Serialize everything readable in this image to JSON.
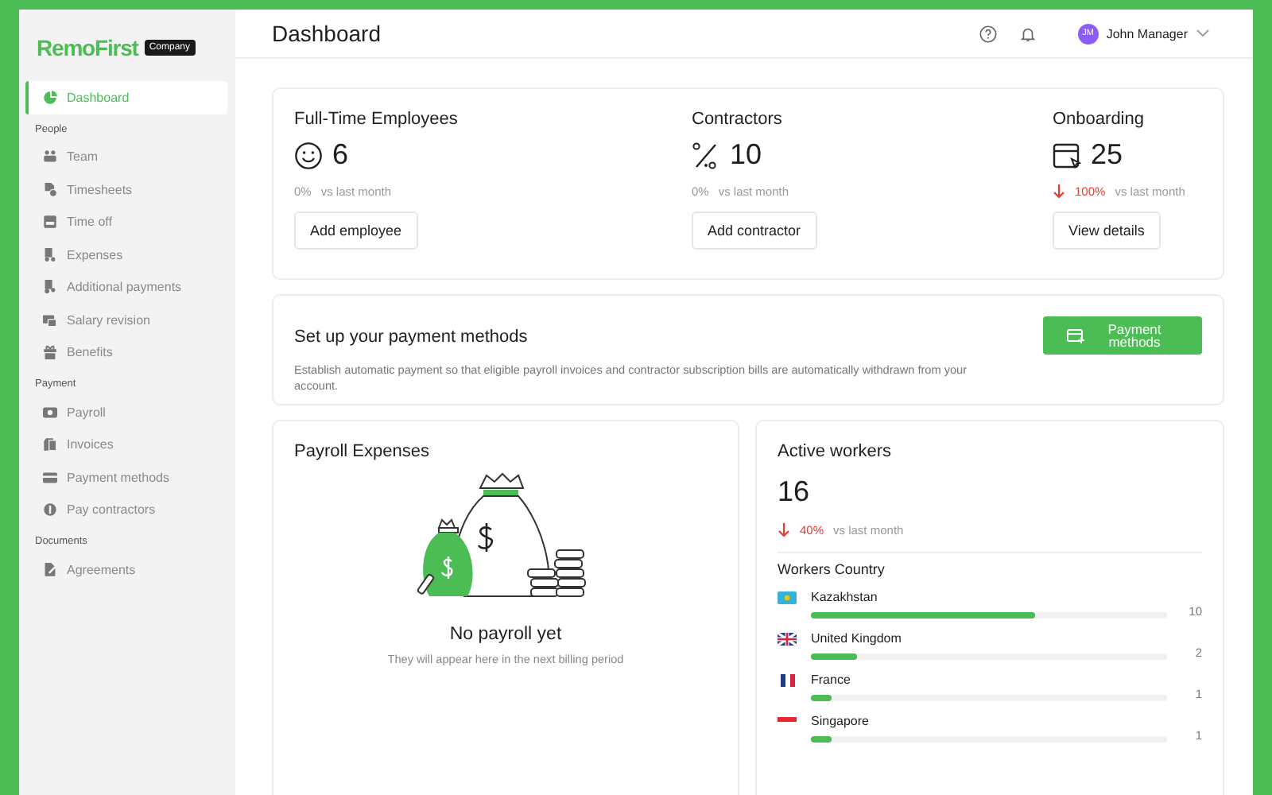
{
  "sidebar": {
    "logo": "RemoFirst",
    "badge": "Company",
    "items": [
      {
        "kind": "item",
        "label": "Dashboard",
        "selected": true
      },
      {
        "kind": "section",
        "label": "People"
      },
      {
        "kind": "item",
        "label": "Team",
        "selected": false
      },
      {
        "kind": "item",
        "label": "Timesheets",
        "selected": false
      },
      {
        "kind": "item",
        "label": "Time off",
        "selected": false
      },
      {
        "kind": "item",
        "label": "Expenses",
        "selected": false
      },
      {
        "kind": "item",
        "label": "Additional payments",
        "selected": false
      },
      {
        "kind": "item",
        "label": "Salary revision",
        "selected": false
      },
      {
        "kind": "item",
        "label": "Benefits",
        "selected": false
      },
      {
        "kind": "section",
        "label": "Payment"
      },
      {
        "kind": "item",
        "label": "Payroll",
        "selected": false
      },
      {
        "kind": "item",
        "label": "Invoices",
        "selected": false
      },
      {
        "kind": "item",
        "label": "Payment methods",
        "selected": false
      },
      {
        "kind": "item",
        "label": "Pay contractors",
        "selected": false
      },
      {
        "kind": "section",
        "label": "Documents"
      },
      {
        "kind": "item",
        "label": "Agreements",
        "selected": false
      }
    ]
  },
  "header": {
    "title": "Dashboard",
    "user": {
      "initials": "JM",
      "name": "John Manager"
    }
  },
  "stats": [
    {
      "title": "Full-Time Employees",
      "value": "6",
      "change": "0%",
      "down": false,
      "note": "vs last month",
      "button": "Add employee"
    },
    {
      "title": "Contractors",
      "value": "10",
      "change": "0%",
      "down": false,
      "note": "vs last month",
      "button": "Add contractor"
    },
    {
      "title": "Onboarding",
      "value": "25",
      "change": "100%",
      "down": true,
      "note": "vs last month",
      "button": "View details"
    }
  ],
  "payment_setup": {
    "title": "Set up your payment methods",
    "text": "Establish automatic payment so that eligible payroll invoices and contractor subscription bills are automatically withdrawn from your account.",
    "button": "Payment methods"
  },
  "payroll": {
    "title": "Payroll Expenses",
    "empty_title": "No payroll yet",
    "empty_text": "They will appear here in the next billing period"
  },
  "workers": {
    "title": "Active workers",
    "value": "16",
    "change": "40%",
    "down": true,
    "note": "vs last month",
    "section_title": "Workers Country",
    "countries": [
      {
        "name": "Kazakhstan",
        "count": "10",
        "level": 0.63
      },
      {
        "name": "United Kingdom",
        "count": "2",
        "level": 0.13
      },
      {
        "name": "France",
        "count": "1",
        "level": 0.06
      },
      {
        "name": "Singapore",
        "count": "1",
        "level": 0.06
      }
    ]
  }
}
